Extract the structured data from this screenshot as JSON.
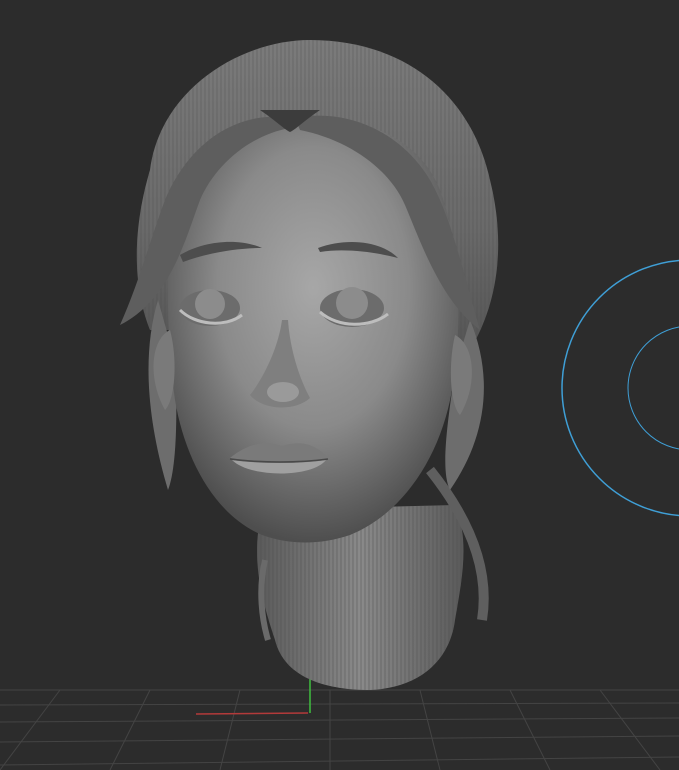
{
  "viewport": {
    "background": "#2c2c2c",
    "model": "sculpted-female-head",
    "icons": [
      "floor-grid-icon",
      "x-axis-icon",
      "y-axis-icon",
      "brush-cursor-icon"
    ]
  },
  "colors": {
    "clay": "#8e8e8e",
    "clay_shadow": "#3a3a3a",
    "grid": "#4a4a4a",
    "x_axis": "#b33a3a",
    "y_axis": "#3fbf3f",
    "brush_cursor": "#3f9fd6"
  }
}
